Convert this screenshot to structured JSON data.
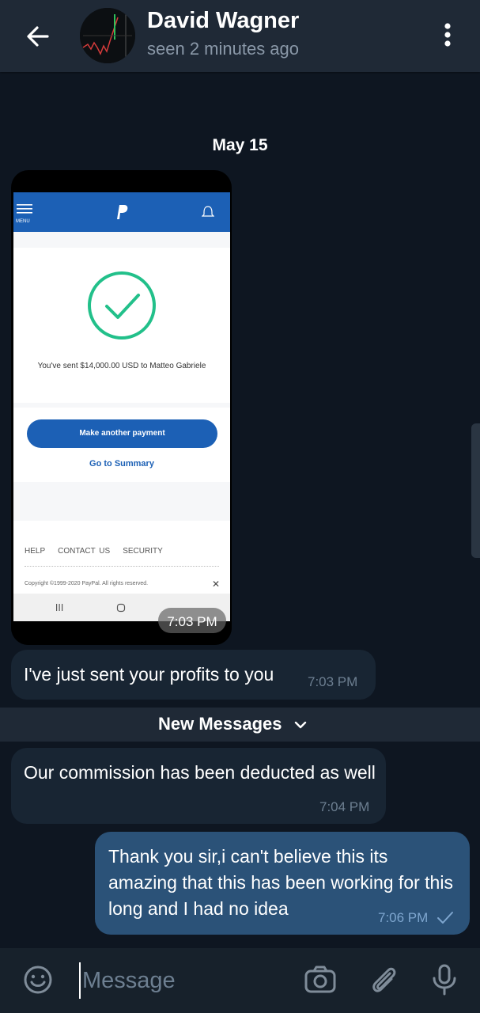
{
  "header": {
    "contact_name": "David Wagner",
    "status": "seen 2 minutes ago",
    "icons": [
      "back-arrow-icon",
      "more-vert-icon"
    ]
  },
  "date_chip": "May 15",
  "photo_message": {
    "time": "7:03 PM",
    "screenshot": {
      "menu_label": "MENU",
      "sent_text": "You've sent $14,000.00 USD to Matteo Gabriele",
      "primary_button": "Make another payment",
      "link": "Go to Summary",
      "footer_links": [
        "HELP",
        "CONTACT US",
        "SECURITY"
      ],
      "copyright": "Copyright ©1999-2020 PayPal. All rights reserved.",
      "close": "✕"
    }
  },
  "messages": [
    {
      "direction": "in",
      "text": "I've just sent your profits to you",
      "time": "7:03 PM"
    },
    {
      "direction": "in",
      "text": "Our commission has been deducted as well",
      "time": "7:04 PM"
    },
    {
      "direction": "out",
      "text": "Thank you sir,i can't believe this its amazing that this has been working for this long and I had no idea",
      "time": "7:06 PM",
      "status": "sent-check-icon"
    }
  ],
  "new_messages_label": "New Messages",
  "composer": {
    "placeholder": "Message",
    "icons": [
      "emoji-icon",
      "camera-icon",
      "attach-icon",
      "mic-icon"
    ]
  },
  "colors": {
    "background": "#0e1621",
    "header": "#1f2936",
    "incoming_bubble": "#182533",
    "outgoing_bubble": "#2b5278",
    "paypal_blue": "#1c60b5",
    "check_green": "#22c08a"
  }
}
